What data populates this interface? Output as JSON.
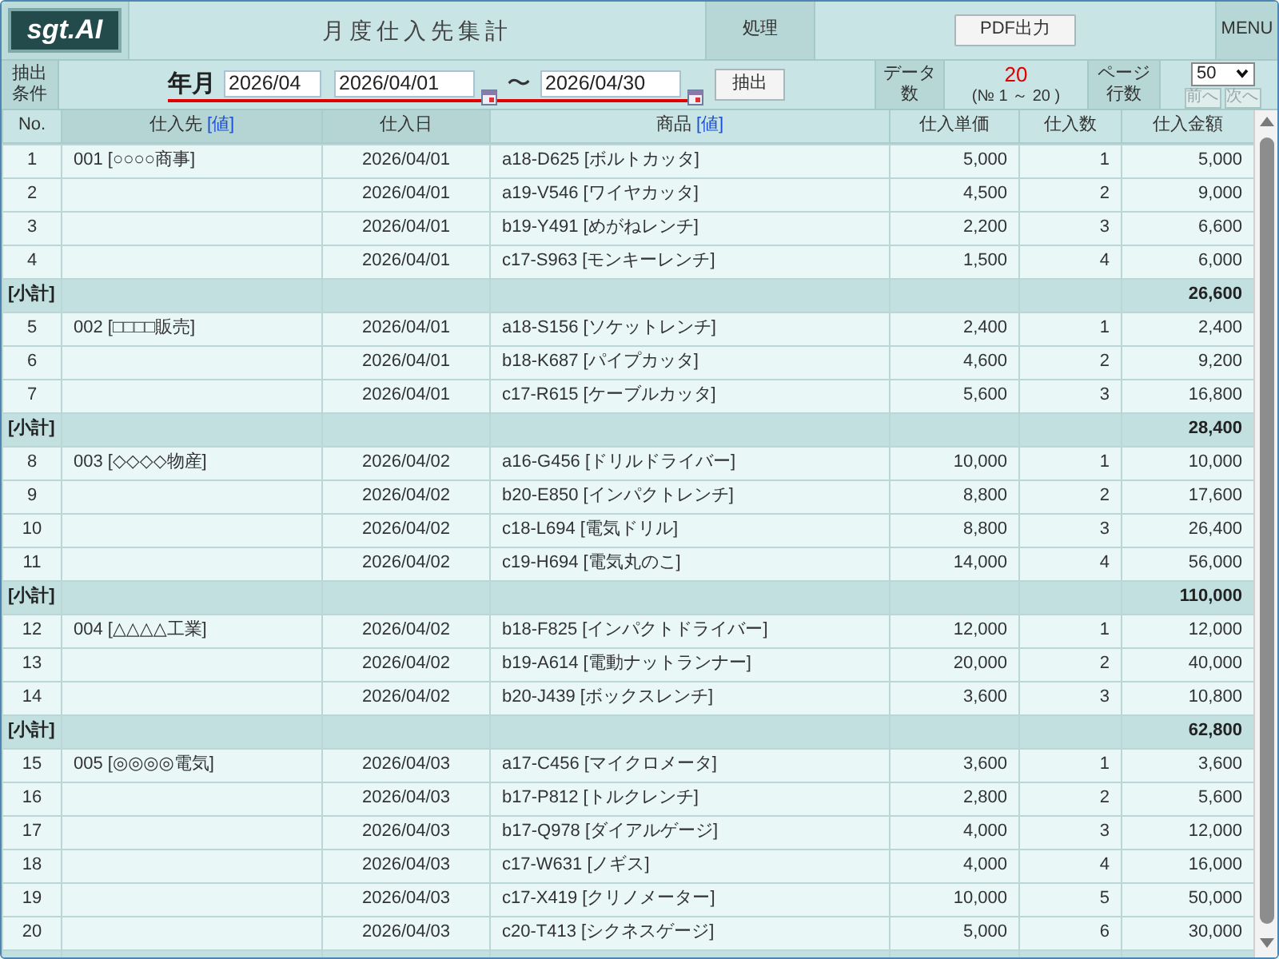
{
  "header": {
    "logo": "sgt.AI",
    "title": "月度仕入先集計",
    "section_label": "処理",
    "pdf_button": "PDF出力",
    "menu": "MENU"
  },
  "filter": {
    "label": "抽出条件",
    "field_label": "年月",
    "month": "2026/04",
    "date_from": "2026/04/01",
    "separator": "〜",
    "date_to": "2026/04/30",
    "extract_button": "抽出",
    "count_label": "データ数",
    "count": "20",
    "range": "(№ 1 ～ 20 )",
    "page_rows_label": "ページ行数",
    "page_rows": "50",
    "prev_button": {
      "label": "前へ",
      "disabled": true
    },
    "next_button": {
      "label": "次へ",
      "disabled": true
    }
  },
  "table": {
    "columns": [
      {
        "label": "No.",
        "highlighted": false
      },
      {
        "label": "仕入先",
        "link": "[値]",
        "highlighted": true
      },
      {
        "label": "仕入日",
        "highlighted": true
      },
      {
        "label": "商品",
        "link": "[値]",
        "highlighted": false
      },
      {
        "label": "仕入単価",
        "highlighted": false
      },
      {
        "label": "仕入数",
        "highlighted": false
      },
      {
        "label": "仕入金額",
        "highlighted": false
      }
    ],
    "rows": [
      {
        "kind": "item",
        "no": "1",
        "supplier": "001 [○○○○商事]",
        "date": "2026/04/01",
        "product": "a18-D625 [ボルトカッタ]",
        "unit_price": "5,000",
        "qty": "1",
        "amount": "5,000"
      },
      {
        "kind": "item",
        "no": "2",
        "date": "2026/04/01",
        "product": "a19-V546 [ワイヤカッタ]",
        "unit_price": "4,500",
        "qty": "2",
        "amount": "9,000"
      },
      {
        "kind": "item",
        "no": "3",
        "date": "2026/04/01",
        "product": "b19-Y491 [めがねレンチ]",
        "unit_price": "2,200",
        "qty": "3",
        "amount": "6,600"
      },
      {
        "kind": "item",
        "no": "4",
        "date": "2026/04/01",
        "product": "c17-S963 [モンキーレンチ]",
        "unit_price": "1,500",
        "qty": "4",
        "amount": "6,000"
      },
      {
        "kind": "subtotal",
        "label": "[小計]",
        "amount": "26,600"
      },
      {
        "kind": "item",
        "no": "5",
        "supplier": "002 [□□□□販売]",
        "date": "2026/04/01",
        "product": "a18-S156 [ソケットレンチ]",
        "unit_price": "2,400",
        "qty": "1",
        "amount": "2,400"
      },
      {
        "kind": "item",
        "no": "6",
        "date": "2026/04/01",
        "product": "b18-K687 [パイプカッタ]",
        "unit_price": "4,600",
        "qty": "2",
        "amount": "9,200"
      },
      {
        "kind": "item",
        "no": "7",
        "date": "2026/04/01",
        "product": "c17-R615 [ケーブルカッタ]",
        "unit_price": "5,600",
        "qty": "3",
        "amount": "16,800"
      },
      {
        "kind": "subtotal",
        "label": "[小計]",
        "amount": "28,400"
      },
      {
        "kind": "item",
        "no": "8",
        "supplier": "003 [◇◇◇◇物産]",
        "date": "2026/04/02",
        "product": "a16-G456 [ドリルドライバー]",
        "unit_price": "10,000",
        "qty": "1",
        "amount": "10,000"
      },
      {
        "kind": "item",
        "no": "9",
        "date": "2026/04/02",
        "product": "b20-E850 [インパクトレンチ]",
        "unit_price": "8,800",
        "qty": "2",
        "amount": "17,600"
      },
      {
        "kind": "item",
        "no": "10",
        "date": "2026/04/02",
        "product": "c18-L694 [電気ドリル]",
        "unit_price": "8,800",
        "qty": "3",
        "amount": "26,400"
      },
      {
        "kind": "item",
        "no": "11",
        "date": "2026/04/02",
        "product": "c19-H694 [電気丸のこ]",
        "unit_price": "14,000",
        "qty": "4",
        "amount": "56,000"
      },
      {
        "kind": "subtotal",
        "label": "[小計]",
        "amount": "110,000"
      },
      {
        "kind": "item",
        "no": "12",
        "supplier": "004 [△△△△工業]",
        "date": "2026/04/02",
        "product": "b18-F825 [インパクトドライバー]",
        "unit_price": "12,000",
        "qty": "1",
        "amount": "12,000"
      },
      {
        "kind": "item",
        "no": "13",
        "date": "2026/04/02",
        "product": "b19-A614 [電動ナットランナー]",
        "unit_price": "20,000",
        "qty": "2",
        "amount": "40,000"
      },
      {
        "kind": "item",
        "no": "14",
        "date": "2026/04/02",
        "product": "b20-J439 [ボックスレンチ]",
        "unit_price": "3,600",
        "qty": "3",
        "amount": "10,800"
      },
      {
        "kind": "subtotal",
        "label": "[小計]",
        "amount": "62,800"
      },
      {
        "kind": "item",
        "no": "15",
        "supplier": "005 [◎◎◎◎電気]",
        "date": "2026/04/03",
        "product": "a17-C456 [マイクロメータ]",
        "unit_price": "3,600",
        "qty": "1",
        "amount": "3,600"
      },
      {
        "kind": "item",
        "no": "16",
        "date": "2026/04/03",
        "product": "b17-P812 [トルクレンチ]",
        "unit_price": "2,800",
        "qty": "2",
        "amount": "5,600"
      },
      {
        "kind": "item",
        "no": "17",
        "date": "2026/04/03",
        "product": "b17-Q978 [ダイアルゲージ]",
        "unit_price": "4,000",
        "qty": "3",
        "amount": "12,000"
      },
      {
        "kind": "item",
        "no": "18",
        "date": "2026/04/03",
        "product": "c17-W631 [ノギス]",
        "unit_price": "4,000",
        "qty": "4",
        "amount": "16,000"
      },
      {
        "kind": "item",
        "no": "19",
        "date": "2026/04/03",
        "product": "c17-X419 [クリノメーター]",
        "unit_price": "10,000",
        "qty": "5",
        "amount": "50,000"
      },
      {
        "kind": "item",
        "no": "20",
        "date": "2026/04/03",
        "product": "c20-T413 [シクネスゲージ]",
        "unit_price": "5,000",
        "qty": "6",
        "amount": "30,000"
      },
      {
        "kind": "subtotal"
      }
    ]
  }
}
